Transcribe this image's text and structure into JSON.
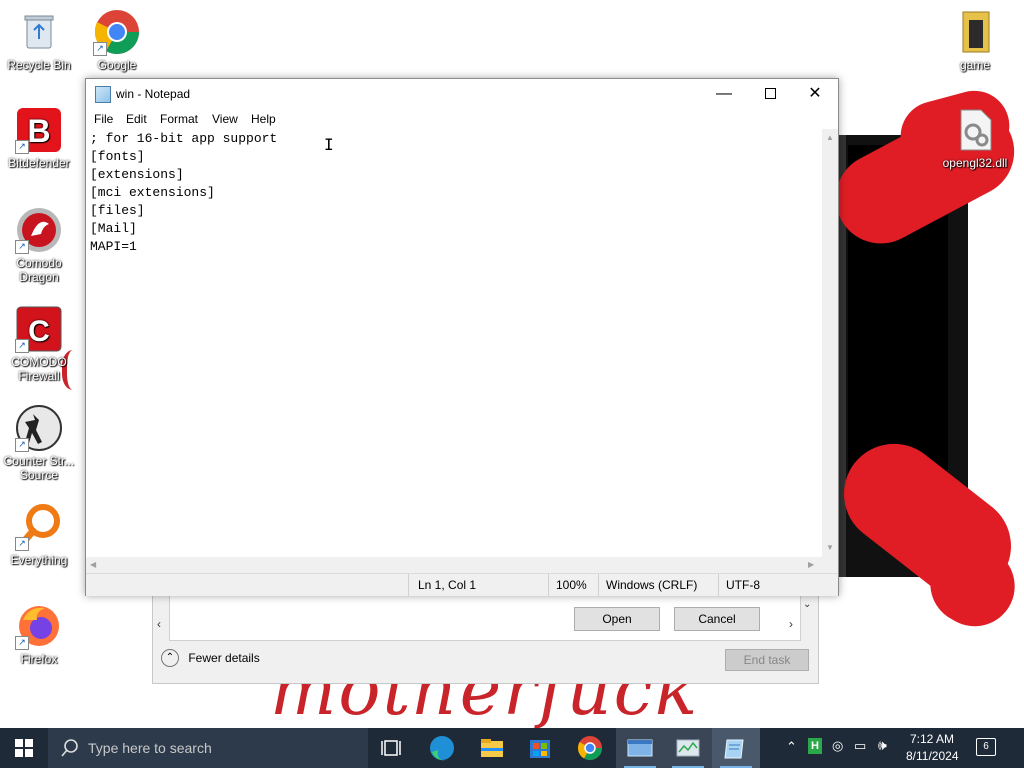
{
  "desktop": {
    "icons_left": [
      {
        "label": "Recycle Bin",
        "icon": "recycle-bin-icon"
      },
      {
        "label": "Bitdefender",
        "icon": "bitdefender-icon"
      },
      {
        "label": "Comodo Dragon",
        "icon": "comodo-dragon-icon"
      },
      {
        "label": "COMODO Firewall",
        "icon": "comodo-firewall-icon"
      },
      {
        "label": "Counter Str... Source",
        "icon": "counter-strike-icon"
      },
      {
        "label": "Everything",
        "icon": "everything-search-icon"
      },
      {
        "label": "Firefox",
        "icon": "firefox-icon"
      }
    ],
    "icon_chrome": {
      "label": "Google",
      "icon": "chrome-icon"
    },
    "icons_right": [
      {
        "label": "game",
        "icon": "game-file-icon"
      },
      {
        "label": "opengl32.dll",
        "icon": "dll-file-icon"
      }
    ],
    "wallpaper_text": "motherfuck"
  },
  "task_manager": {
    "open_label": "Open",
    "cancel_label": "Cancel",
    "fewer_details": "Fewer details",
    "end_task": "End task"
  },
  "notepad": {
    "title": "win - Notepad",
    "menu": [
      "File",
      "Edit",
      "Format",
      "View",
      "Help"
    ],
    "lines": [
      "; for 16-bit app support",
      "[fonts]",
      "[extensions]",
      "[mci extensions]",
      "[files]",
      "[Mail]",
      "MAPI=1"
    ],
    "status": {
      "position": "Ln 1, Col 1",
      "zoom": "100%",
      "line_ending": "Windows (CRLF)",
      "encoding": "UTF-8"
    }
  },
  "taskbar": {
    "search_placeholder": "Type here to search",
    "pinned": [
      "task-view-icon",
      "edge-icon",
      "file-explorer-icon",
      "store-icon",
      "chrome-icon",
      "window-app-icon",
      "task-manager-icon",
      "notepad-icon"
    ],
    "time": "7:12 AM",
    "date": "8/11/2024",
    "notification_count": "6"
  },
  "colors": {
    "taskbar_bg": "#1f2a38",
    "accent_red": "#e01d25",
    "active_underline": "#78b4e8"
  }
}
